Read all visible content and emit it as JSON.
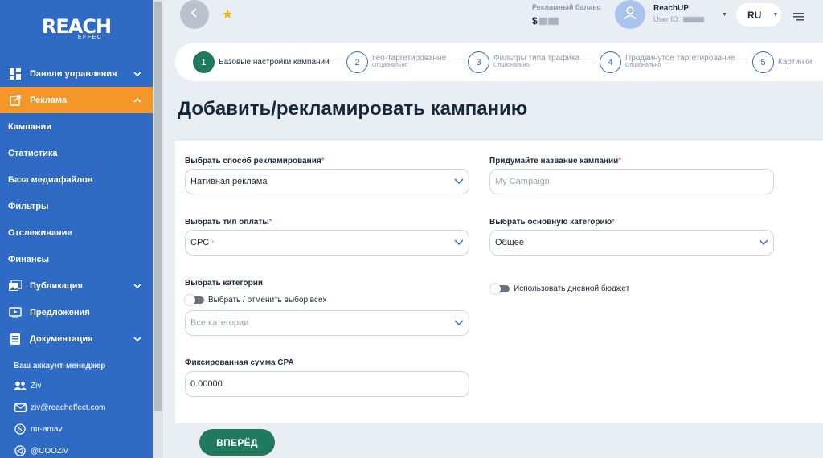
{
  "brand": {
    "logo_main": "REACH",
    "logo_sub": "EFFECT"
  },
  "sidebar": {
    "items": [
      {
        "label": "Панели управления",
        "icon": "dashboard-icon",
        "chevron": "down"
      },
      {
        "label": "Реклама",
        "icon": "external-link-icon",
        "chevron": "up",
        "active": true
      },
      {
        "label": "Кампании"
      },
      {
        "label": "Статистика"
      },
      {
        "label": "База медиафайлов"
      },
      {
        "label": "Фильтры"
      },
      {
        "label": "Отслеживание"
      },
      {
        "label": "Финансы"
      },
      {
        "label": "Публикация",
        "icon": "image-gallery-icon",
        "chevron": "down"
      },
      {
        "label": "Предложения",
        "icon": "play-screen-icon"
      },
      {
        "label": "Документация",
        "icon": "document-icon",
        "chevron": "down"
      }
    ],
    "manager_title": "Ваш аккаунт-менеджер",
    "manager": {
      "name": "Ziv",
      "email": "ziv@reacheffect.com",
      "skype": "mr-amav",
      "telegram": "@COOZiv"
    }
  },
  "topbar": {
    "balance_label": "Рекламный баланс",
    "balance_currency": "$",
    "username": "ReachUP",
    "user_id_label": "User ID:",
    "language": "RU"
  },
  "stepper": {
    "steps": [
      {
        "num": "1",
        "title": "Базовые настройки кампании",
        "optional": "",
        "active": true
      },
      {
        "num": "2",
        "title": "Гео-таргетирование",
        "optional": "Опционально"
      },
      {
        "num": "3",
        "title": "Фильтры типа трафика",
        "optional": "Опционально"
      },
      {
        "num": "4",
        "title": "Продвинутое таргетирование",
        "optional": "Опционально"
      },
      {
        "num": "5",
        "title": "Картинки",
        "optional": ""
      }
    ]
  },
  "page_title": "Добавить/рекламировать кампанию",
  "form": {
    "ad_method_label": "Выбрать способ рекламирования",
    "ad_method_value": "Нативная реклама",
    "campaign_name_label": "Придумайте название кампании",
    "campaign_name_placeholder": "My Campaign",
    "payment_type_label": "Выбрать тип оплаты",
    "payment_type_value": "CPC",
    "main_category_label": "Выбрать основную категорию",
    "main_category_value": "Общее",
    "categories_label": "Выбрать категории",
    "select_all_label": "Выбрать / отменить выбор всех",
    "categories_placeholder": "Все категории",
    "daily_budget_label": "Использовать дневной бюджет",
    "cpa_label": "Фиксированная сумма CPA",
    "cpa_value": "0.00000",
    "required_mark": "*"
  },
  "next_button": "ВПЕРЁД"
}
